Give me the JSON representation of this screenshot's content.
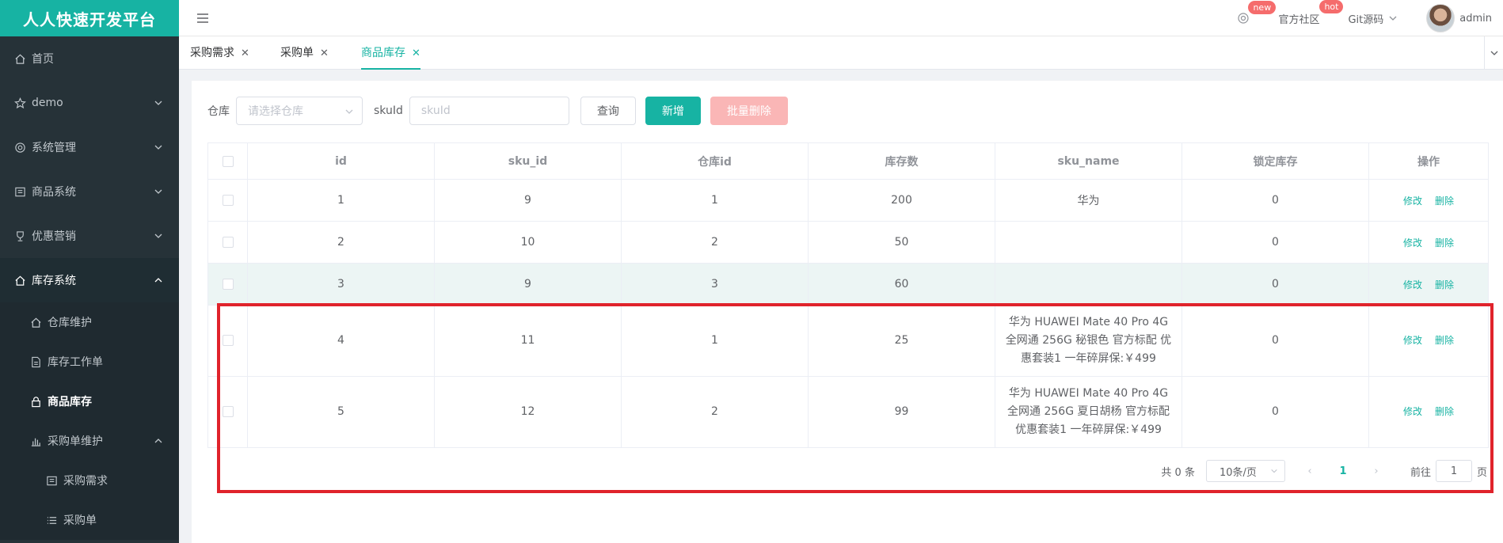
{
  "brand": "人人快速开发平台",
  "sidebar": {
    "items": [
      {
        "label": "首页"
      },
      {
        "label": "demo"
      },
      {
        "label": "系统管理"
      },
      {
        "label": "商品系统"
      },
      {
        "label": "优惠营销"
      },
      {
        "label": "库存系统"
      }
    ],
    "stock_sub": [
      {
        "label": "仓库维护"
      },
      {
        "label": "库存工作单"
      },
      {
        "label": "商品库存"
      },
      {
        "label": "采购单维护"
      }
    ],
    "purchase_sub": [
      {
        "label": "采购需求"
      },
      {
        "label": "采购单"
      }
    ]
  },
  "header": {
    "settings_badge": "new",
    "community": "官方社区",
    "community_badge": "hot",
    "git": "Git源码",
    "user": "admin"
  },
  "tabs": [
    {
      "label": "采购需求"
    },
    {
      "label": "采购单"
    },
    {
      "label": "商品库存"
    }
  ],
  "form": {
    "warehouse_label": "仓库",
    "warehouse_placeholder": "请选择仓库",
    "skuid_label": "skuId",
    "skuid_placeholder": "skuId",
    "query": "查询",
    "add": "新增",
    "batch_delete": "批量删除"
  },
  "table": {
    "headers": [
      "id",
      "sku_id",
      "仓库id",
      "库存数",
      "sku_name",
      "锁定库存",
      "操作"
    ],
    "rows": [
      {
        "id": "1",
        "sku_id": "9",
        "wid": "1",
        "stock": "200",
        "name": "华为",
        "locked": "0"
      },
      {
        "id": "2",
        "sku_id": "10",
        "wid": "2",
        "stock": "50",
        "name": "",
        "locked": "0"
      },
      {
        "id": "3",
        "sku_id": "9",
        "wid": "3",
        "stock": "60",
        "name": "",
        "locked": "0"
      },
      {
        "id": "4",
        "sku_id": "11",
        "wid": "1",
        "stock": "25",
        "name": "华为 HUAWEI Mate 40 Pro 4G 全网通 256G 秘银色 官方标配 优惠套装1 一年碎屏保:￥499",
        "locked": "0"
      },
      {
        "id": "5",
        "sku_id": "12",
        "wid": "2",
        "stock": "99",
        "name": "华为 HUAWEI Mate 40 Pro 4G 全网通 256G 夏日胡杨 官方标配 优惠套装1 一年碎屏保:￥499",
        "locked": "0"
      }
    ],
    "edit": "修改",
    "delete": "删除"
  },
  "pager": {
    "total": "共 0 条",
    "size": "10条/页",
    "current": "1",
    "goto": "前往",
    "page_value": "1",
    "page_unit": "页"
  },
  "colors": {
    "accent": "#17b3a3",
    "highlight": "#e0232b",
    "sidebar": "#263238"
  }
}
